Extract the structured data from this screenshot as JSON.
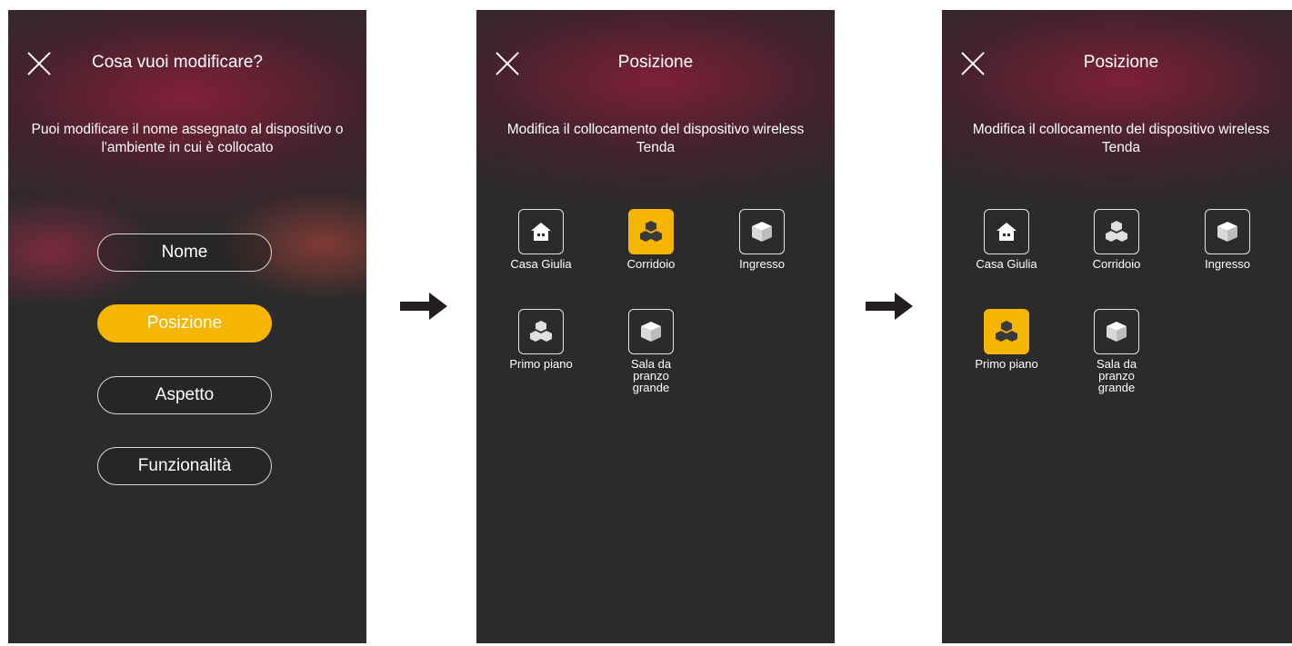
{
  "screen1": {
    "title": "Cosa vuoi modificare?",
    "subtitle": "Puoi modificare il nome assegnato al dispositivo o l'ambiente in cui è collocato",
    "options": [
      "Nome",
      "Posizione",
      "Aspetto",
      "Funzionalità"
    ],
    "selected_option": "Posizione"
  },
  "screen2": {
    "title": "Posizione",
    "subtitle": "Modifica il collocamento del dispositivo wireless Tenda",
    "locations": [
      {
        "label": "Casa Giulia",
        "icon": "house-icon"
      },
      {
        "label": "Corridoio",
        "icon": "cubes-icon"
      },
      {
        "label": "Ingresso",
        "icon": "cube-icon"
      },
      {
        "label": "Primo piano",
        "icon": "cubes-icon"
      },
      {
        "label": "Sala da pranzo grande",
        "icon": "cube-icon"
      }
    ],
    "selected": "Corridoio"
  },
  "screen3": {
    "title": "Posizione",
    "subtitle": "Modifica il collocamento del dispositivo wireless Tenda",
    "locations": [
      {
        "label": "Casa Giulia",
        "icon": "house-icon"
      },
      {
        "label": "Corridoio",
        "icon": "cubes-icon"
      },
      {
        "label": "Ingresso",
        "icon": "cube-icon"
      },
      {
        "label": "Primo piano",
        "icon": "cubes-icon"
      },
      {
        "label": "Sala da pranzo grande",
        "icon": "cube-icon"
      }
    ],
    "selected": "Primo piano"
  },
  "colors": {
    "accent": "#f6b500",
    "background": "#2b2b2b",
    "glow": "#8c1e3c"
  }
}
